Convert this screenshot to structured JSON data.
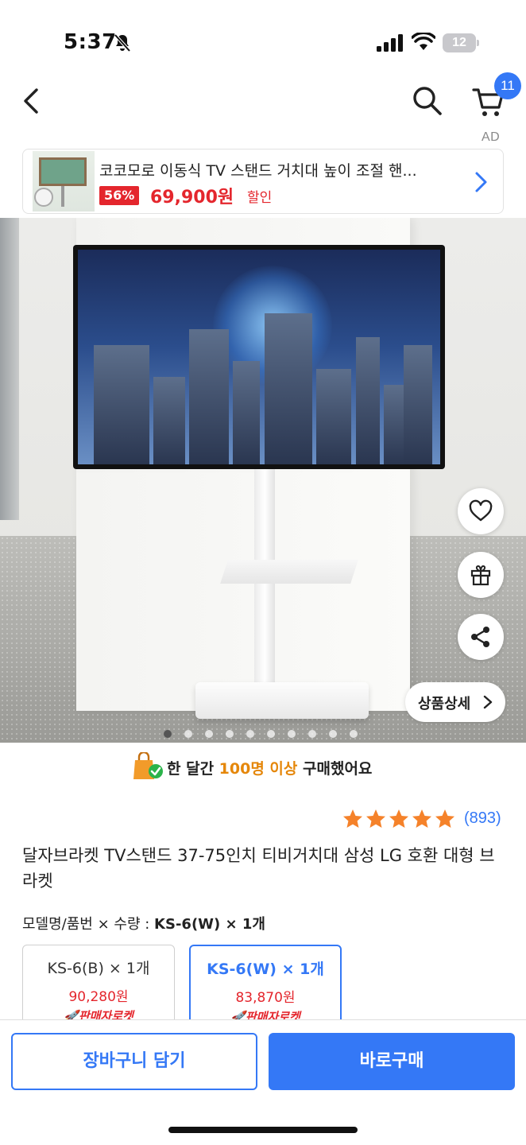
{
  "status_bar": {
    "time": "5:37",
    "battery": "12"
  },
  "nav": {
    "cart_count": "11",
    "ad_label": "AD"
  },
  "ad": {
    "title": "코코모로 이동식 TV 스탠드 거치대 높이 조절 핸...",
    "discount": "56%",
    "price": "69,900원",
    "sale_label": "할인"
  },
  "hero": {
    "detail_label": "상품상세",
    "page_count": 10,
    "active_page": 0
  },
  "purchase": {
    "prefix": "한 달간 ",
    "highlight": "100명 이상",
    "suffix": " 구매했어요"
  },
  "rating": {
    "stars": 5,
    "count": "(893)"
  },
  "product": {
    "title": "달자브라켓 TV스탠드 37-75인치 티비거치대 삼성 LG 호환 대형 브라켓"
  },
  "options": {
    "label": "모델명/품번 × 수량 : ",
    "selected_value": "KS-6(W) × 1개",
    "items": [
      {
        "name": "KS-6(B) × 1개",
        "price": "90,280원",
        "badge": "판매자로켓"
      },
      {
        "name": "KS-6(W) × 1개",
        "price": "83,870원",
        "badge": "판매자로켓"
      }
    ]
  },
  "actions": {
    "cart_label": "장바구니 담기",
    "buy_label": "바로구매"
  },
  "colors": {
    "accent": "#3478f6",
    "price_red": "#e4262d",
    "highlight_orange": "#e5870a",
    "star": "#f5822a"
  }
}
